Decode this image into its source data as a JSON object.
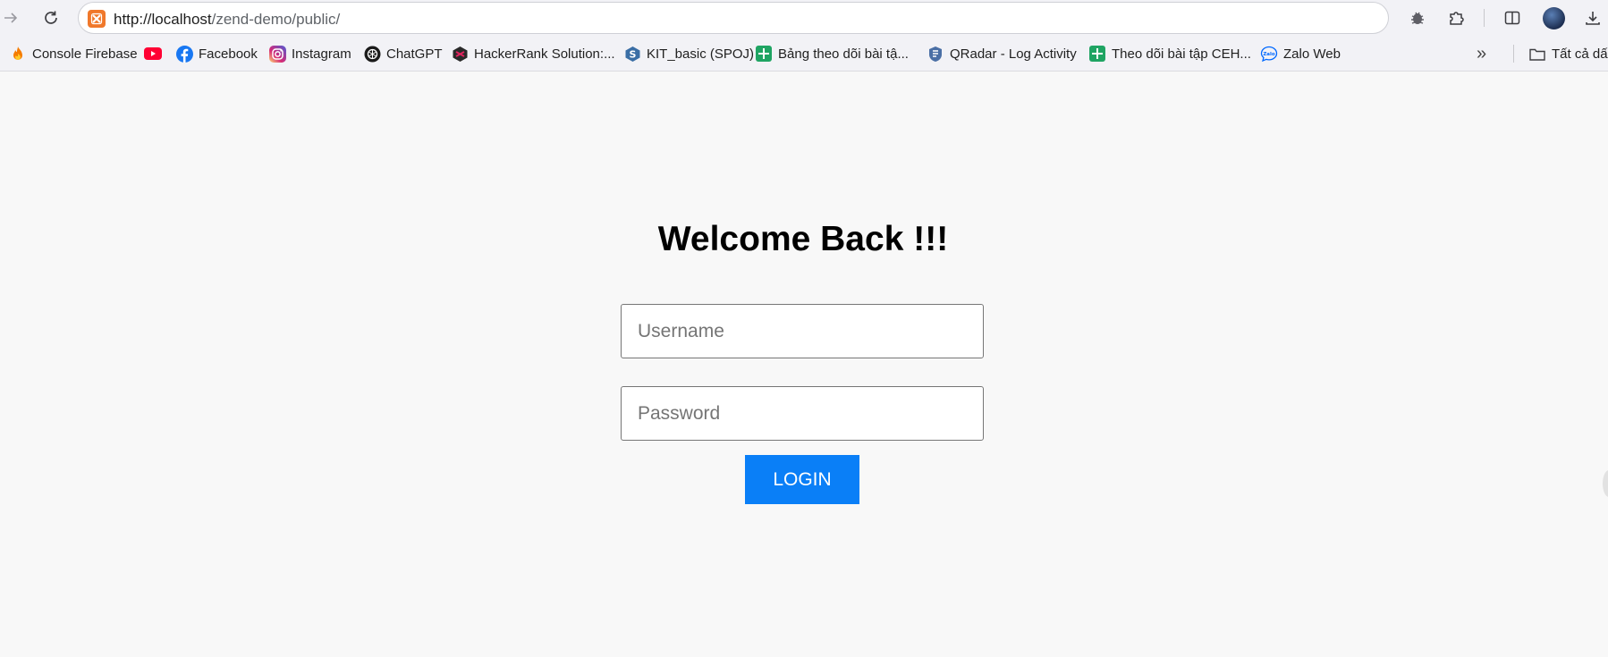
{
  "browser": {
    "url_host": "http://localhost",
    "url_path": "/zend-demo/public/"
  },
  "bookmarks": [
    {
      "label": "Console Firebase",
      "icon": "firebase-icon"
    },
    {
      "label": "",
      "icon": "youtube-icon"
    },
    {
      "label": "Facebook",
      "icon": "facebook-icon"
    },
    {
      "label": "Instagram",
      "icon": "instagram-icon"
    },
    {
      "label": "ChatGPT",
      "icon": "chatgpt-icon"
    },
    {
      "label": "HackerRank Solution:...",
      "icon": "hackerrank-icon"
    },
    {
      "label": "KIT_basic (SPOJ)",
      "icon": "spoj-icon"
    },
    {
      "label": "Bảng theo dõi bài tậ...",
      "icon": "google-sheets-icon"
    },
    {
      "label": "QRadar - Log Activity",
      "icon": "qradar-icon"
    },
    {
      "label": "Theo dõi bài tập CEH...",
      "icon": "google-sheets-icon"
    },
    {
      "label": "Zalo Web",
      "icon": "zalo-icon"
    }
  ],
  "bookmarks_overflow": "»",
  "all_bookmarks_label": "Tất cả dấu",
  "zalo_icon_text": "Zalo",
  "login": {
    "heading": "Welcome Back !!!",
    "username_placeholder": "Username",
    "password_placeholder": "Password",
    "button_label": "LOGIN"
  },
  "colors": {
    "login_button": "#0a7ff7",
    "page_background": "#f8f8f8",
    "toolbar_background": "#f2f2f6"
  }
}
